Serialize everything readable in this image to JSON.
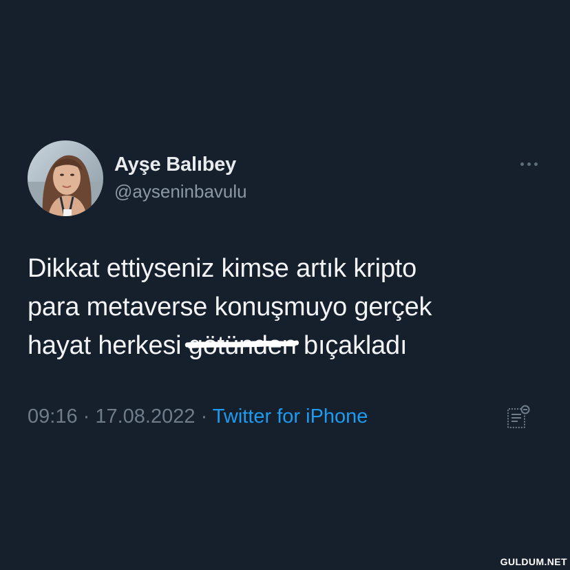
{
  "tweet": {
    "author": {
      "display_name": "Ayşe Balıbey",
      "handle": "@ayseninbavulu",
      "avatar": "profile-photo"
    },
    "text_line_1": "Dikkat ettiyseniz kimse artık kripto",
    "text_line_2": "para metaverse konuşmuyo gerçek",
    "text_line_3_before": "hayat herkesi ",
    "text_line_3_struck": "götünden",
    "text_line_3_after": " bıçakladı",
    "time": "09:16",
    "separator": " · ",
    "date": "17.08.2022",
    "source": "Twitter for iPhone",
    "more_icon": "more-horizontal-icon",
    "analytics_icon": "view-analytics-icon"
  },
  "watermark": "GULDUM.NET",
  "colors": {
    "background": "#16202c",
    "primary_text": "#f2f4f6",
    "secondary_text": "#8b98a5",
    "link": "#1d9bf0"
  }
}
